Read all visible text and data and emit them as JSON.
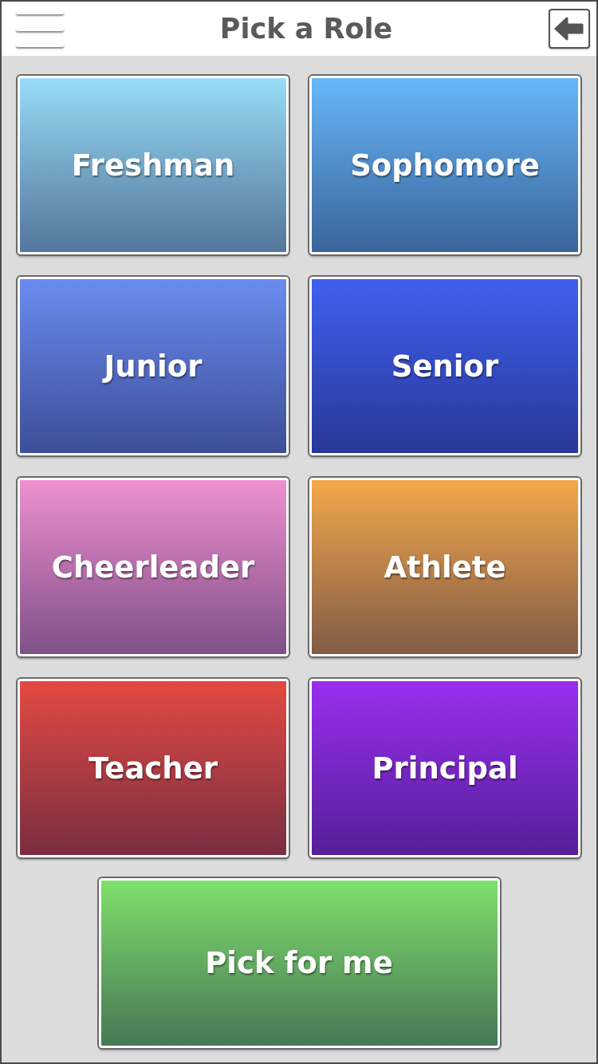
{
  "header": {
    "title": "Pick a Role"
  },
  "roles": [
    {
      "label": "Freshman",
      "color": "#98dcf8"
    },
    {
      "label": "Sophomore",
      "color": "#66b8f8"
    },
    {
      "label": "Junior",
      "color": "#6a8cf0"
    },
    {
      "label": "Senior",
      "color": "#4060f0"
    },
    {
      "label": "Cheerleader",
      "color": "#f090d0"
    },
    {
      "label": "Athlete",
      "color": "#f4a848"
    },
    {
      "label": "Teacher",
      "color": "#e44a40"
    },
    {
      "label": "Principal",
      "color": "#9a2ef0"
    }
  ],
  "pick_for_me": {
    "label": "Pick for me",
    "color": "#80e06a"
  }
}
